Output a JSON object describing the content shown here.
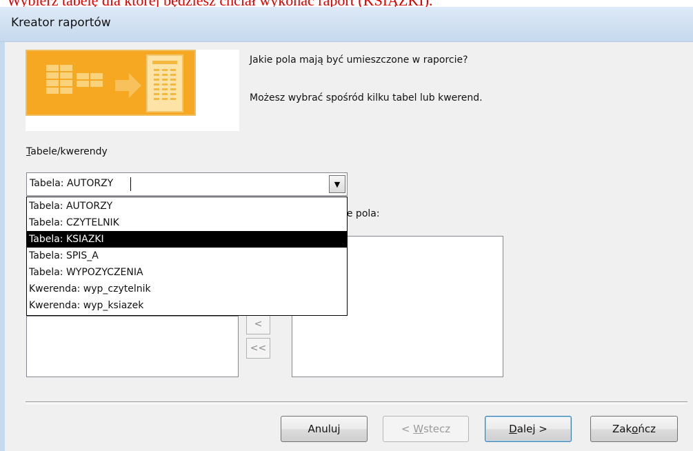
{
  "caption": "Wybierz tabelę dla której będziesz chciał wykonać raport (KSIĄŻKI).",
  "window": {
    "title": "Kreator raportów"
  },
  "prompt": {
    "line1": "Jakie pola mają być umieszczone w raporcie?",
    "line2": "Możesz wybrać spośród kilku tabel lub kwerend."
  },
  "tables_label": {
    "hotkey": "T",
    "rest": "abele/kwerendy"
  },
  "combo": {
    "value": "Tabela: AUTORZY",
    "button_icon": "chevron-down-icon"
  },
  "dropdown": {
    "items": [
      "Tabela: AUTORZY",
      "Tabela: CZYTELNIK",
      "Tabela: KSIAZKI",
      "Tabela: SPIS_A",
      "Tabela: WYPOZYCZENIA",
      "Kwerenda: wyp_czytelnik",
      "Kwerenda: wyp_ksiazek"
    ],
    "selected_index": 2
  },
  "selected_fields_label": "ne pola:",
  "move_buttons": {
    "remove_one": "<",
    "remove_all": "<<"
  },
  "buttons": {
    "cancel": "Anuluj",
    "back_prefix": "< ",
    "back_hotkey": "W",
    "back_rest": "stecz",
    "next_hotkey": "D",
    "next_rest": "alej >",
    "finish_pre": "Zak",
    "finish_hotkey": "o",
    "finish_rest": "ńcz"
  },
  "colors": {
    "caption": "#e00000",
    "selection": "#000000",
    "wizard_art": "#f7a823"
  }
}
